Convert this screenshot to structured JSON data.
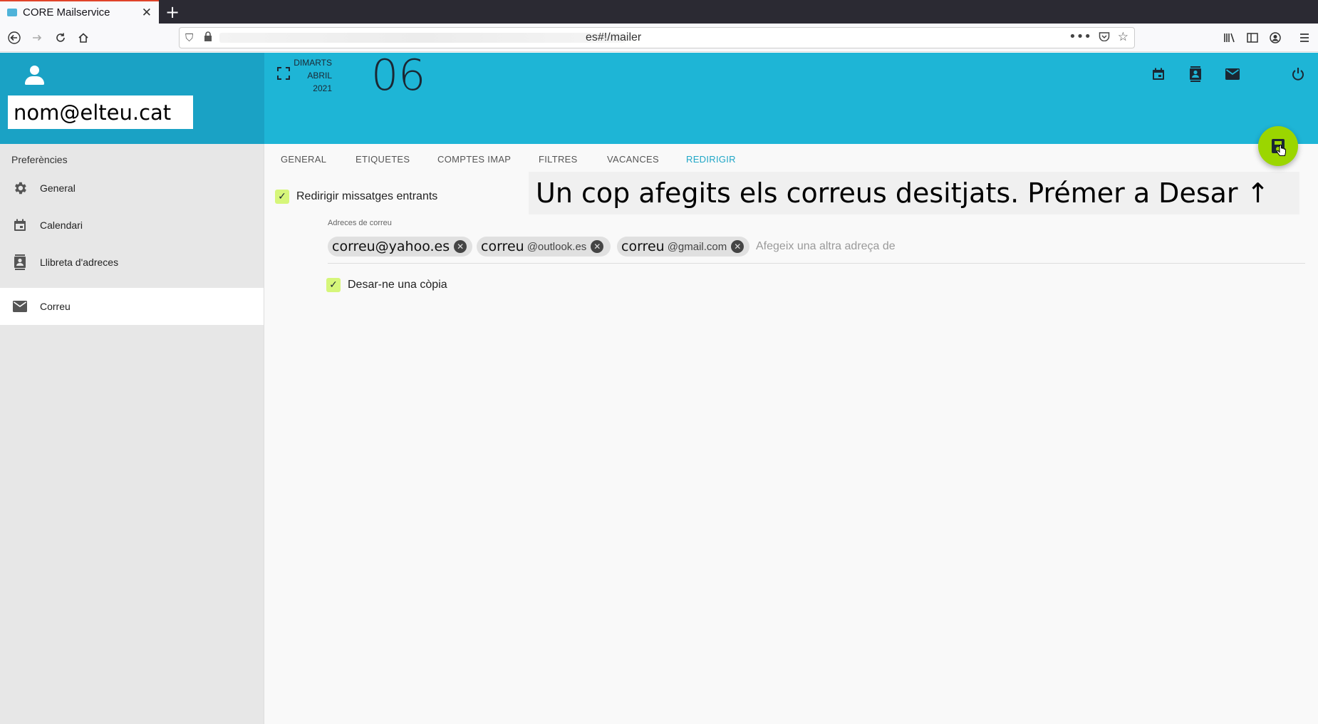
{
  "browser": {
    "tab_title": "CORE Mailservice",
    "url_visible": "es#!/mailer"
  },
  "sidebar": {
    "user_email": "nom@elteu.cat",
    "section_title": "Preferències",
    "items": [
      {
        "label": "General",
        "icon": "gear-icon"
      },
      {
        "label": "Calendari",
        "icon": "calendar-icon"
      },
      {
        "label": "Llibreta d'adreces",
        "icon": "contacts-icon"
      },
      {
        "label": "Correu",
        "icon": "mail-icon",
        "active": true
      }
    ]
  },
  "header": {
    "weekday": "DIMARTS",
    "month": "ABRIL",
    "year": "2021",
    "day": "06"
  },
  "tabs": [
    {
      "label": "GENERAL"
    },
    {
      "label": "ETIQUETES"
    },
    {
      "label": "COMPTES IMAP"
    },
    {
      "label": "FILTRES"
    },
    {
      "label": "VACANCES"
    },
    {
      "label": "REDIRIGIR",
      "active": true
    }
  ],
  "forward": {
    "enable_label": "Redirigir missatges entrants",
    "enabled": true,
    "addresses_label": "Adreces de correu",
    "chips": [
      {
        "main": "correu@yahoo.es",
        "suffix": ""
      },
      {
        "main": "correu",
        "suffix": "@outlook.es"
      },
      {
        "main": "correu",
        "suffix": "@gmail.com"
      }
    ],
    "add_placeholder": "Afegeix una altra adreça de",
    "keep_copy_label": "Desar-ne una còpia",
    "keep_copy": true
  },
  "annotation": "Un cop afegits els correus desitjats. Prémer a Desar ↑",
  "colors": {
    "header_accent": "#1eb5d6",
    "sidebar_header": "#1aa2c5",
    "fab": "#9bd600",
    "checkbox": "#d6f67a",
    "active_tab": "#1fa6c6"
  }
}
